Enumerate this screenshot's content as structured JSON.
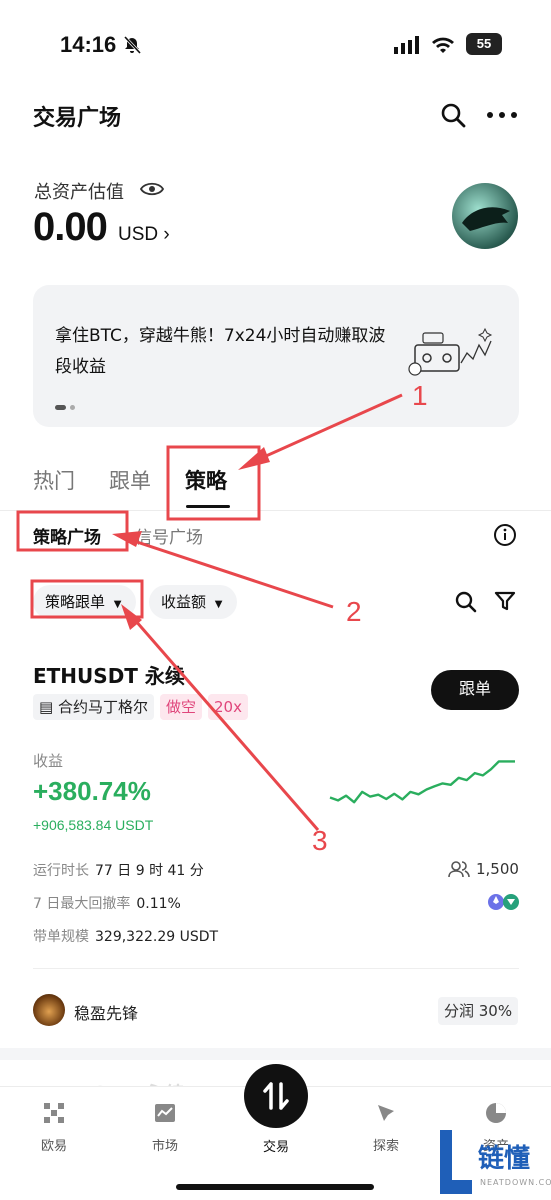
{
  "status_bar": {
    "time": "14:16",
    "battery": "55"
  },
  "header": {
    "title": "交易广场"
  },
  "assets": {
    "label": "总资产估值",
    "value": "0.00",
    "unit": "USD"
  },
  "banner": {
    "text": "拿住BTC，穿越牛熊！7x24小时自动赚取波段收益"
  },
  "main_tabs": [
    {
      "label": "热门"
    },
    {
      "label": "跟单"
    },
    {
      "label": "策略"
    }
  ],
  "sub_tabs": [
    {
      "label": "策略广场"
    },
    {
      "label": "信号广场"
    }
  ],
  "filters": {
    "strategy_follow": "策略跟单",
    "profit_amount": "收益额"
  },
  "card": {
    "title": "ETHUSDT 永续",
    "tags": [
      "合约马丁格尔",
      "做空",
      "20x"
    ],
    "follow_button": "跟单",
    "profit_label": "收益",
    "profit_pct": "+380.74%",
    "profit_amount": "+906,583.84 USDT",
    "stats": {
      "runtime_label": "运行时长",
      "runtime_value": "77 日 9 时 41 分",
      "drawdown_label": "7 日最大回撤率",
      "drawdown_value": "0.11%",
      "scale_label": "带单规模",
      "scale_value": "329,322.29 USDT"
    },
    "followers": "1,500",
    "trader_name": "稳盈先锋",
    "profit_share": "分润 30%",
    "sparkline": [
      0.18,
      0.12,
      0.22,
      0.08,
      0.3,
      0.2,
      0.24,
      0.15,
      0.26,
      0.14,
      0.3,
      0.25,
      0.35,
      0.42,
      0.48,
      0.45,
      0.6,
      0.55,
      0.7,
      0.65,
      0.78,
      0.95,
      0.95,
      0.95
    ]
  },
  "card2": {
    "title": "ETHUSDT 永续"
  },
  "bottom_nav": [
    {
      "label": "欧易"
    },
    {
      "label": "市场"
    },
    {
      "label": "交易"
    },
    {
      "label": "探索"
    },
    {
      "label": "资产"
    }
  ],
  "annotations": [
    "1",
    "2",
    "3"
  ],
  "watermark": {
    "text": "链懂",
    "sub": "NEATDOWN.COM"
  },
  "colors": {
    "green": "#2aae5e",
    "annotation_red": "#e8474c",
    "pink_tag": "#e0457b"
  }
}
